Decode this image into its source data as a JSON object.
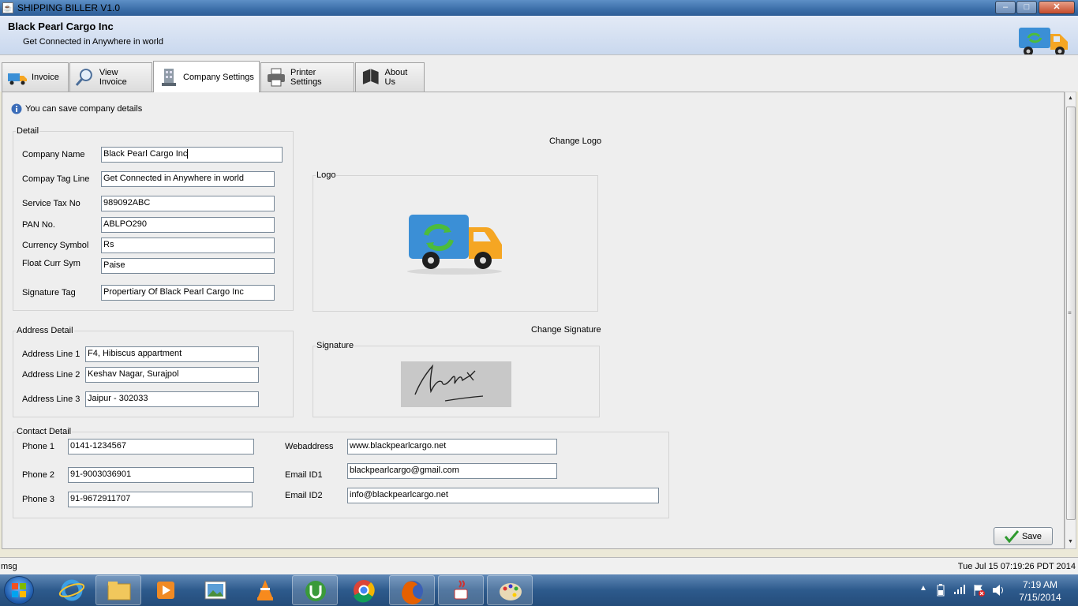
{
  "window": {
    "title": "SHIPPING BILLER V1.0",
    "min": "–",
    "max": "□",
    "close": "✕"
  },
  "header": {
    "company": "Black Pearl Cargo Inc",
    "tagline": "Get Connected in Anywhere in world"
  },
  "tabs": [
    {
      "label": "Invoice",
      "icon": "truck-icon"
    },
    {
      "label": "View Invoice",
      "icon": "magnifier-icon"
    },
    {
      "label": "Company Settings",
      "icon": "building-icon"
    },
    {
      "label": "Printer Settings",
      "icon": "printer-icon"
    },
    {
      "label": "About Us",
      "icon": "book-icon"
    }
  ],
  "info": "You can save company details",
  "detail": {
    "legend": "Detail",
    "fields": [
      {
        "label": "Company Name",
        "value": "Black Pearl Cargo Inc"
      },
      {
        "label": "Compay Tag Line",
        "value": "Get Connected in Anywhere in world"
      },
      {
        "label": "Service Tax No",
        "value": "989092ABC"
      },
      {
        "label": "PAN No.",
        "value": "ABLPO290"
      },
      {
        "label": "Currency Symbol",
        "value": "Rs"
      },
      {
        "label": "Float Curr Sym",
        "value": "Paise"
      },
      {
        "label": "Signature Tag",
        "value": "Propertiary Of  Black Pearl Cargo Inc"
      }
    ]
  },
  "logo": {
    "change": "Change Logo",
    "legend": "Logo"
  },
  "signature": {
    "change": "Change Signature",
    "legend": "Signature"
  },
  "address": {
    "legend": "Address Detail",
    "fields": [
      {
        "label": "Address Line 1",
        "value": "F4, Hibiscus appartment"
      },
      {
        "label": "Address Line 2",
        "value": "Keshav Nagar, Surajpol"
      },
      {
        "label": "Address Line 3",
        "value": "Jaipur - 302033"
      }
    ]
  },
  "contact": {
    "legend": "Contact Detail",
    "phones": [
      {
        "label": "Phone 1",
        "value": "0141-1234567"
      },
      {
        "label": "Phone 2",
        "value": "91-9003036901"
      },
      {
        "label": "Phone 3",
        "value": "91-9672911707"
      }
    ],
    "web": [
      {
        "label": "Webaddress",
        "value": "www.blackpearlcargo.net"
      },
      {
        "label": "Email ID1",
        "value": "blackpearlcargo@gmail.com"
      },
      {
        "label": "Email ID2",
        "value": "info@blackpearlcargo.net"
      }
    ]
  },
  "save": "Save",
  "status": {
    "msg": "msg",
    "time": "Tue Jul 15 07:19:26 PDT 2014"
  },
  "taskbar": {
    "time": "7:19 AM",
    "date": "7/15/2014"
  },
  "colors": {
    "truck_body": "#3b8fd6",
    "truck_cab": "#f5a623",
    "arrows": "#4cbc3c",
    "accent": "#3b6ea8"
  }
}
